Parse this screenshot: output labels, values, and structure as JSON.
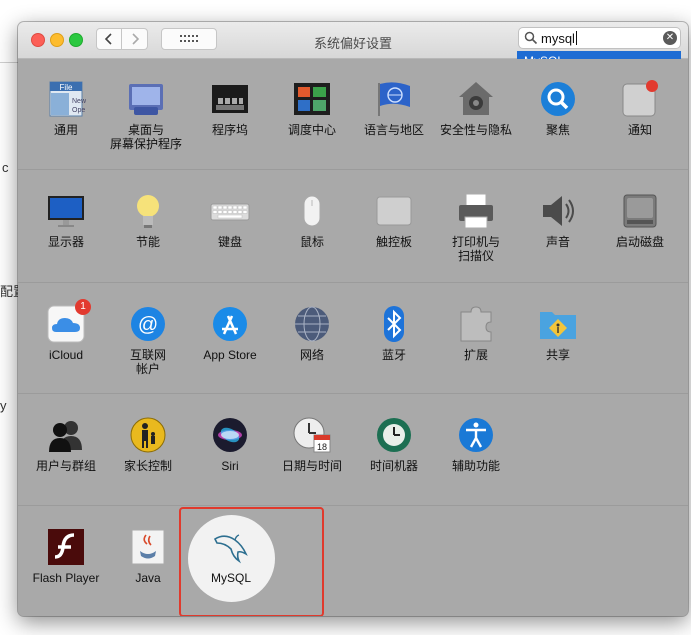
{
  "window": {
    "title": "系统偏好设置"
  },
  "search": {
    "query": "mysql",
    "suggestion": "MySQL"
  },
  "panes": {
    "general": "通用",
    "desktop": "桌面与\n屏幕保护程序",
    "dock": "程序坞",
    "mission": "调度中心",
    "language": "语言与地区",
    "security": "安全性与隐私",
    "spotlight": "聚焦",
    "notifications": "通知",
    "displays": "显示器",
    "energy": "节能",
    "keyboard": "键盘",
    "mouse": "鼠标",
    "trackpad": "触控板",
    "printers": "打印机与\n扫描仪",
    "sound": "声音",
    "startup": "启动磁盘",
    "icloud": "iCloud",
    "internet": "互联网\n帐户",
    "appstore": "App Store",
    "network": "网络",
    "bluetooth": "蓝牙",
    "extensions": "扩展",
    "sharing": "共享",
    "users": "用户与群组",
    "parental": "家长控制",
    "siri": "Siri",
    "datetime": "日期与时间",
    "timemachine": "时间机器",
    "accessibility": "辅助功能",
    "flash": "Flash Player",
    "java": "Java",
    "mysql": "MySQL"
  },
  "badges": {
    "icloud": "1"
  },
  "icons": {
    "general": "file-icon",
    "desktop": "desktop-icon",
    "dock": "dock-icon",
    "mission": "mission-control-icon",
    "language": "globe-flag-icon",
    "security": "house-icon",
    "spotlight": "magnifier-icon",
    "notifications": "notification-icon",
    "displays": "monitor-icon",
    "energy": "lightbulb-icon",
    "keyboard": "keyboard-icon",
    "mouse": "mouse-icon",
    "trackpad": "trackpad-icon",
    "printers": "printer-icon",
    "sound": "speaker-icon",
    "startup": "disk-icon",
    "icloud": "cloud-icon",
    "internet": "at-icon",
    "appstore": "app-store-icon",
    "network": "globe-icon",
    "bluetooth": "bluetooth-icon",
    "extensions": "puzzle-icon",
    "sharing": "folder-icon",
    "users": "users-icon",
    "parental": "parental-icon",
    "siri": "siri-icon",
    "datetime": "clock-calendar-icon",
    "timemachine": "time-machine-icon",
    "accessibility": "accessibility-icon",
    "flash": "flash-icon",
    "java": "java-icon",
    "mysql": "dolphin-icon"
  },
  "colors": {
    "highlight_border": "#e03a2d",
    "suggestion_bg": "#1e6cd3",
    "pane_bg": "#a9a9a9"
  },
  "background_text": {
    "frag1": "c",
    "frag2": "配置",
    "frag3": "y"
  }
}
